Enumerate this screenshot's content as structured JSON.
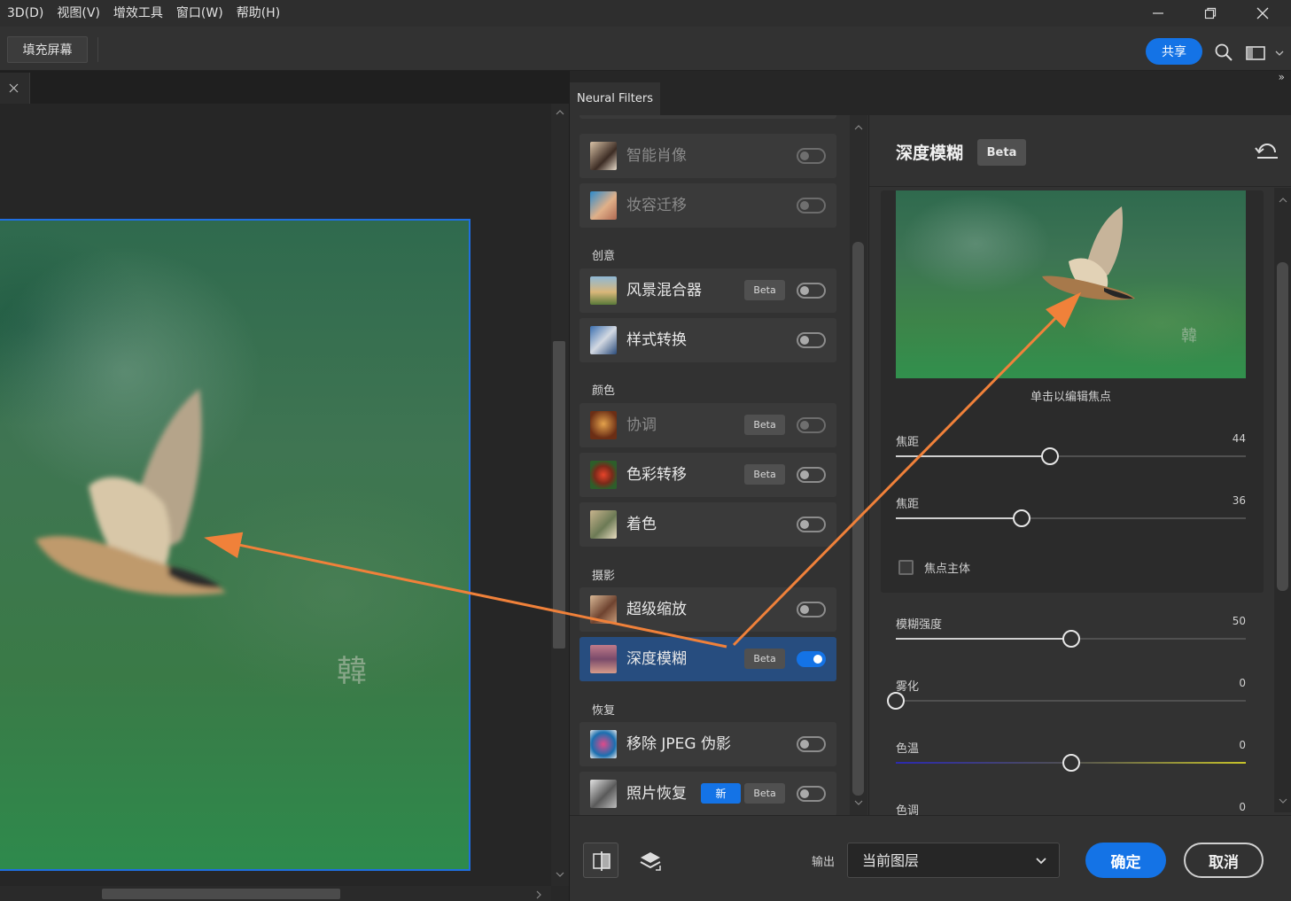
{
  "menu": {
    "items": [
      "3D(D)",
      "视图(V)",
      "增效工具",
      "窗口(W)",
      "帮助(H)"
    ]
  },
  "options_bar": {
    "fill_screen": "填充屏幕",
    "share": "共享"
  },
  "document": {
    "watermark_glyph": "韓"
  },
  "neural_filters": {
    "tab_label": "Neural Filters",
    "collapse_glyph": "»",
    "categories": {
      "creative": "创意",
      "color": "颜色",
      "photography": "摄影",
      "restore": "恢复"
    },
    "filters": [
      {
        "label": "智能肖像",
        "disabled": true,
        "on": false
      },
      {
        "label": "妆容迁移",
        "disabled": true,
        "on": false
      },
      {
        "label": "风景混合器",
        "beta": "Beta",
        "on": false
      },
      {
        "label": "样式转换",
        "on": false
      },
      {
        "label": "协调",
        "beta": "Beta",
        "disabled": true,
        "on": false
      },
      {
        "label": "色彩转移",
        "beta": "Beta",
        "on": false
      },
      {
        "label": "着色",
        "on": false
      },
      {
        "label": "超级缩放",
        "on": false
      },
      {
        "label": "深度模糊",
        "beta": "Beta",
        "on": true,
        "active": true
      },
      {
        "label": "移除 JPEG 伪影",
        "on": false
      },
      {
        "label": "照片恢复",
        "new": "新",
        "beta": "Beta",
        "on": false
      }
    ],
    "settings": {
      "title": "深度模糊",
      "beta": "Beta",
      "preview_caption": "单击以编辑焦点",
      "sliders": [
        {
          "label": "焦距",
          "value": "44",
          "fraction": 0.44
        },
        {
          "label": "焦距",
          "value": "36",
          "fraction": 0.36
        },
        {
          "label": "模糊强度",
          "value": "50",
          "fraction": 0.5
        },
        {
          "label": "雾化",
          "value": "0",
          "fraction": 0.0
        },
        {
          "label": "色温",
          "value": "0",
          "fraction": 0.5
        },
        {
          "label": "色调",
          "value": "0",
          "fraction": 0.5
        }
      ],
      "focus_subject": "焦点主体"
    },
    "bottom": {
      "output_label": "输出",
      "output_value": "当前图层",
      "ok": "确定",
      "cancel": "取消"
    }
  },
  "colors": {
    "accent": "#1473e6",
    "arrow": "#f0813a",
    "active_row": "#274d7f"
  }
}
